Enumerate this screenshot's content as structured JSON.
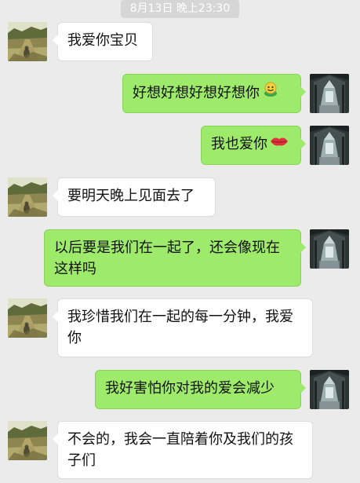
{
  "timestamp": "8月13日 晚上23:30",
  "colors": {
    "background": "#ebebeb",
    "sent_bubble": "#9eea6a",
    "received_bubble": "#ffffff"
  },
  "messages": [
    {
      "side": "left",
      "text": "我爱你宝贝",
      "emoji": ""
    },
    {
      "side": "right",
      "text": "好想好想好想好想你",
      "emoji": "smiley-emoji"
    },
    {
      "side": "right",
      "text": "我也爱你",
      "emoji": "lips-emoji"
    },
    {
      "side": "left",
      "text": "要明天晚上见面去了",
      "emoji": ""
    },
    {
      "side": "right",
      "text": "以后要是我们在一起了，还会像现在这样吗",
      "emoji": ""
    },
    {
      "side": "left",
      "text": "我珍惜我们在一起的每一分钟，我爱你",
      "emoji": ""
    },
    {
      "side": "right",
      "text": "我好害怕你对我的爱会减少",
      "emoji": ""
    },
    {
      "side": "left",
      "text": "不会的，我会一直陪着你及我们的孩子们",
      "emoji": ""
    }
  ]
}
